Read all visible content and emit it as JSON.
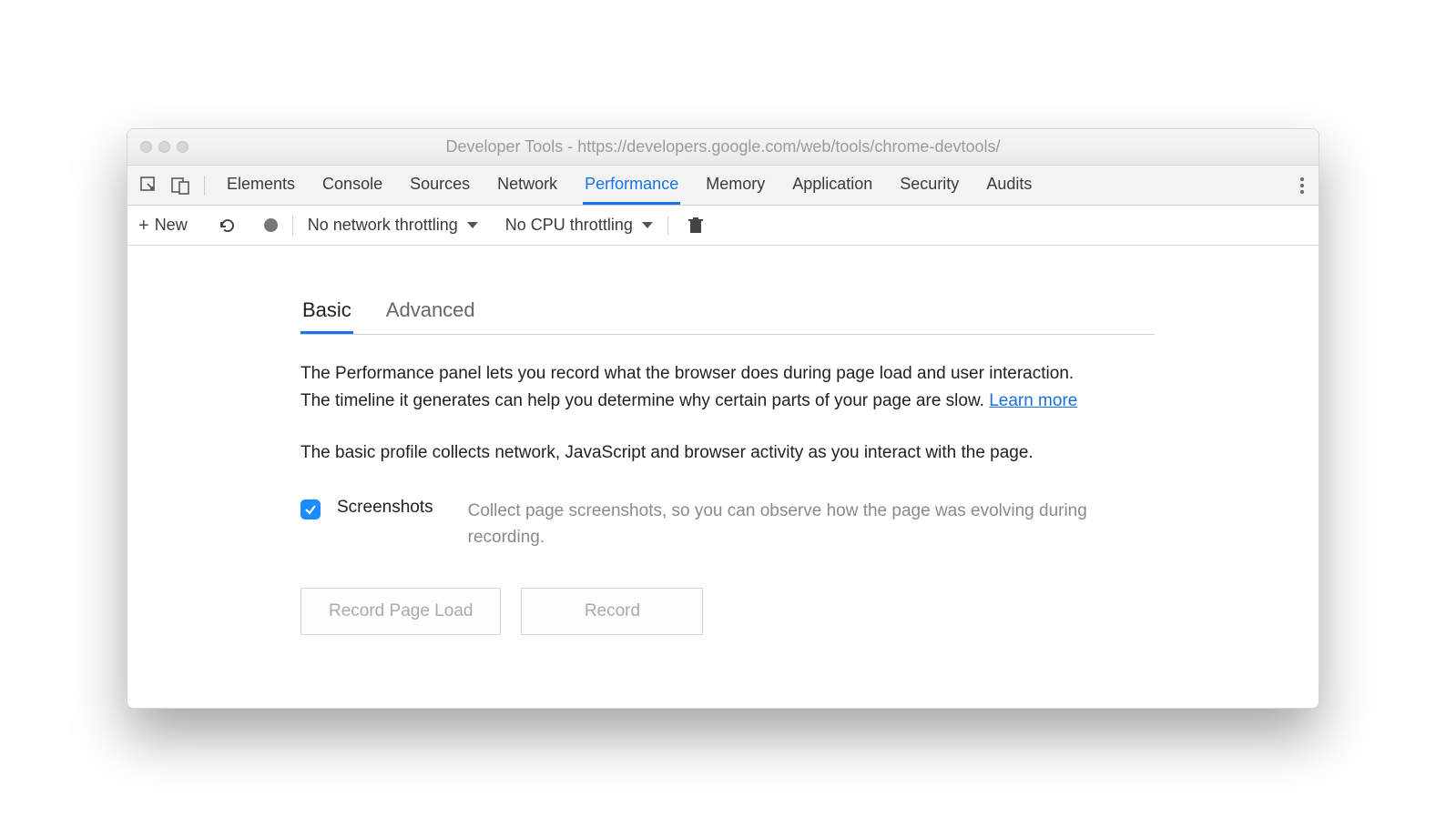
{
  "window": {
    "title": "Developer Tools - https://developers.google.com/web/tools/chrome-devtools/"
  },
  "mainTabs": [
    "Elements",
    "Console",
    "Sources",
    "Network",
    "Performance",
    "Memory",
    "Application",
    "Security",
    "Audits"
  ],
  "activeMainTab": "Performance",
  "toolbar": {
    "new_label": "New",
    "network_throttle": "No network throttling",
    "cpu_throttle": "No CPU throttling"
  },
  "panel": {
    "tabs": [
      "Basic",
      "Advanced"
    ],
    "activeTab": "Basic",
    "intro": "The Performance panel lets you record what the browser does during page load and user interaction. The timeline it generates can help you determine why certain parts of your page are slow.  ",
    "learn_more": "Learn more",
    "basic_desc": "The basic profile collects network, JavaScript and browser activity as you interact with the page.",
    "option_label": "Screenshots",
    "option_desc": "Collect page screenshots, so you can observe how the page was evolving during recording.",
    "btn_page_load": "Record Page Load",
    "btn_record": "Record"
  }
}
